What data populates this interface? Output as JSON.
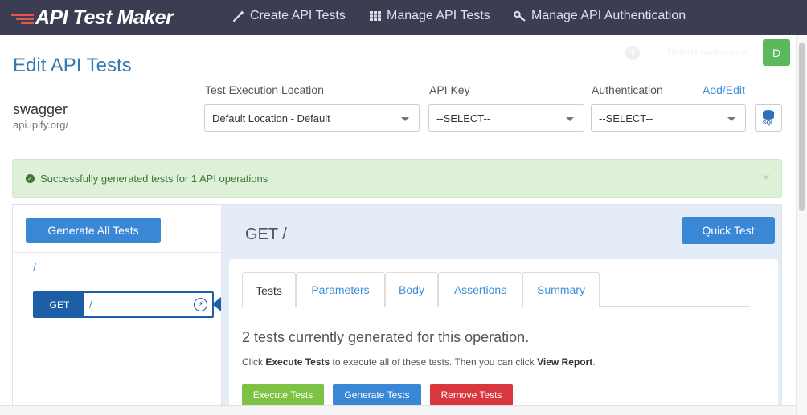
{
  "brand": {
    "name": "API Test Maker"
  },
  "nav": {
    "create": "Create API Tests",
    "manage": "Manage API Tests",
    "auth": "Manage API Authentication"
  },
  "header": {
    "title": "Edit API Tests",
    "help": "?",
    "workspace": "Default workspace",
    "avatar_initial": "D"
  },
  "api": {
    "name": "swagger",
    "host": "api.ipify.org/"
  },
  "fields": {
    "location_label": "Test Execution Location",
    "location_value": "Default Location - Default",
    "api_key_label": "API Key",
    "api_key_value": "--SELECT--",
    "auth_label": "Authentication",
    "auth_value": "--SELECT--",
    "add_edit": "Add/Edit",
    "sql_label": "SQL"
  },
  "alert": {
    "message": "Successfully generated tests for 1 API operations",
    "close": "×"
  },
  "left": {
    "generate_all": "Generate All Tests",
    "path": "/",
    "operation": {
      "method": "GET",
      "path": "/"
    }
  },
  "right": {
    "operation_title": "GET /",
    "quick_test": "Quick Test",
    "tabs": [
      "Tests",
      "Parameters",
      "Body",
      "Assertions",
      "Summary"
    ],
    "generated_count": "2 tests currently generated for this operation.",
    "hint": {
      "p1": "Click ",
      "b1": "Execute Tests",
      "p2": " to execute all of these tests. Then you can click ",
      "b2": "View Report",
      "p3": "."
    },
    "actions": {
      "execute": "Execute Tests",
      "generate": "Generate Tests",
      "remove": "Remove Tests"
    }
  },
  "colors": {
    "navbar": "#3c3d52",
    "accent": "#3a87d6",
    "success_bg": "#dff0d8",
    "execute": "#7dc242",
    "remove": "#d9363e"
  }
}
